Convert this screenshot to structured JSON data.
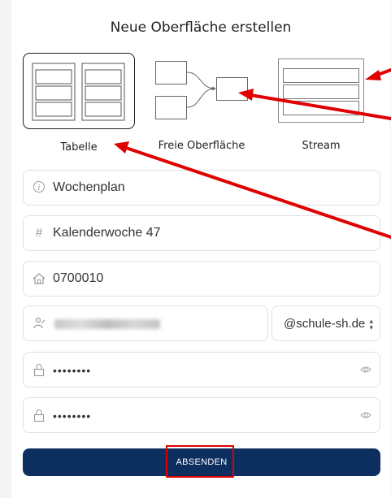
{
  "dialog": {
    "title": "Neue Oberfläche erstellen"
  },
  "layout_choices": [
    {
      "label": "Tabelle",
      "icon": "table-layout-icon",
      "selected": true
    },
    {
      "label": "Freie Oberfläche",
      "icon": "freeform-layout-icon",
      "selected": false
    },
    {
      "label": "Stream",
      "icon": "stream-layout-icon",
      "selected": false
    }
  ],
  "form": {
    "name": {
      "value": "Wochenplan",
      "icon": "info-icon"
    },
    "tag": {
      "value": "Kalenderwoche 47",
      "icon": "hash-icon"
    },
    "room": {
      "value": "0700010",
      "icon": "home-icon"
    },
    "user": {
      "value": "",
      "icon": "user-icon",
      "domain": "@schule-sh.de"
    },
    "password": {
      "value": "••••••••",
      "icon": "lock-icon"
    },
    "password_confirm": {
      "value": "••••••••",
      "icon": "lock-icon"
    },
    "submit_label": "ABSENDEN"
  },
  "colors": {
    "primary": "#0d2f5f",
    "annotation": "#e00000",
    "background": "#f4f4f6"
  }
}
